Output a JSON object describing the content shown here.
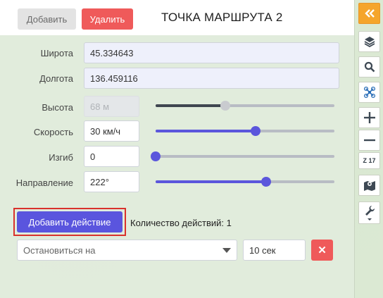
{
  "header": {
    "add_label": "Добавить",
    "delete_label": "Удалить",
    "title": "ТОЧКА МАРШРУТА 2"
  },
  "fields": {
    "latitude_label": "Широта",
    "latitude_value": "45.334643",
    "longitude_label": "Долгота",
    "longitude_value": "136.459116",
    "altitude_label": "Высота",
    "altitude_value": "68 м",
    "altitude_slider": 0.39,
    "speed_label": "Скорость",
    "speed_value": "30 км/ч",
    "speed_slider": 0.56,
    "bend_label": "Изгиб",
    "bend_value": "0",
    "bend_slider": 0.0,
    "direction_label": "Направление",
    "direction_value": "222°",
    "direction_slider": 0.62
  },
  "actions": {
    "add_action_label": "Добавить действие",
    "count_text": "Количество действий: 1",
    "action_type": "Остановиться на",
    "action_duration": "10 сек",
    "remove_symbol": "✕"
  },
  "toolbar": {
    "zoom_label": "Z 17",
    "items": [
      "collapse-icon",
      "layers-icon",
      "search-icon",
      "drone-icon",
      "zoom-in-icon",
      "zoom-out-icon",
      "zoom-level",
      "map-pin-icon",
      "wrench-icon"
    ]
  },
  "colors": {
    "accent": "#5a55de",
    "danger": "#ef5a5a",
    "toolbar_orange": "#f5a52b"
  }
}
